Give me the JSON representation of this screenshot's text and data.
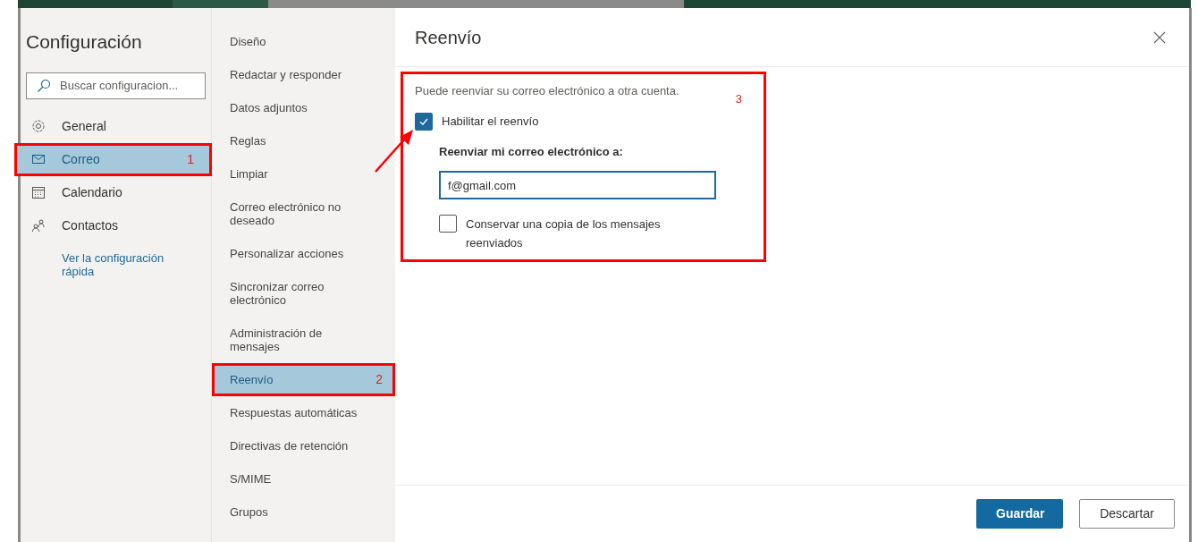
{
  "sidebar": {
    "title": "Configuración",
    "search": {
      "placeholder": "Buscar configuracion..."
    },
    "items": [
      {
        "label": "General",
        "kind": "gear",
        "selected": false
      },
      {
        "label": "Correo",
        "kind": "mail",
        "selected": true,
        "annotation": "1"
      },
      {
        "label": "Calendario",
        "kind": "calendar",
        "selected": false
      },
      {
        "label": "Contactos",
        "kind": "people",
        "selected": false
      }
    ],
    "link": "Ver la configuración rápida"
  },
  "subnav": {
    "items": [
      {
        "label": "Diseño",
        "selected": false
      },
      {
        "label": "Redactar y responder",
        "selected": false
      },
      {
        "label": "Datos adjuntos",
        "selected": false
      },
      {
        "label": "Reglas",
        "selected": false
      },
      {
        "label": "Limpiar",
        "selected": false
      },
      {
        "label": "Correo electrónico no deseado",
        "selected": false
      },
      {
        "label": "Personalizar acciones",
        "selected": false
      },
      {
        "label": "Sincronizar correo electrónico",
        "selected": false
      },
      {
        "label": "Administración de mensajes",
        "selected": false
      },
      {
        "label": "Reenvío",
        "selected": true,
        "annotation": "2"
      },
      {
        "label": "Respuestas automáticas",
        "selected": false
      },
      {
        "label": "Directivas de retención",
        "selected": false
      },
      {
        "label": "S/MIME",
        "selected": false
      },
      {
        "label": "Grupos",
        "selected": false
      }
    ]
  },
  "panel": {
    "title": "Reenvío",
    "annotation": "3",
    "description": "Puede reenviar su correo electrónico a otra cuenta.",
    "enable": {
      "label": "Habilitar el reenvío",
      "checked": true
    },
    "field": {
      "label": "Reenviar mi correo electrónico a:",
      "value": "f@gmail.com"
    },
    "keep_copy": {
      "label": "Conservar una copia de los mensajes reenviados",
      "checked": false
    },
    "buttons": [
      {
        "label": "Guardar",
        "kind": "primary"
      },
      {
        "label": "Descartar",
        "kind": "secondary"
      }
    ]
  }
}
